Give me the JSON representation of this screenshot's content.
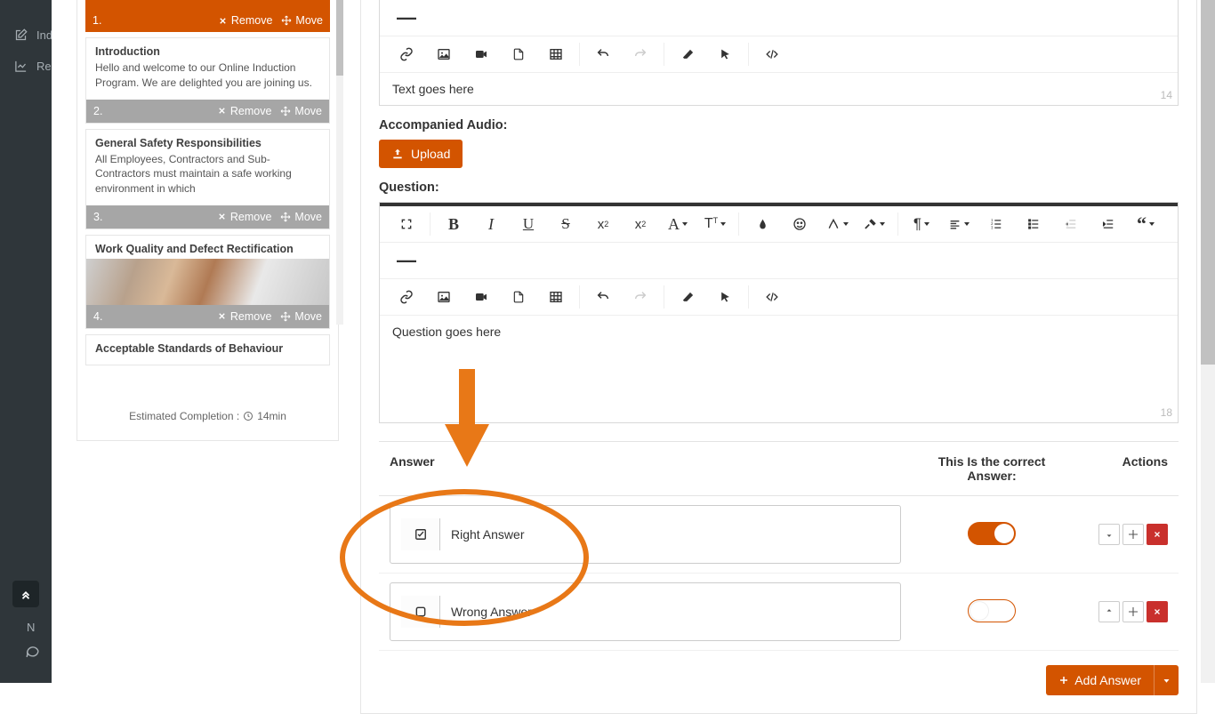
{
  "sidebar_nav": {
    "item1": "Induc",
    "item2": "Repo",
    "bottom_letter": "N"
  },
  "slides": [
    {
      "num": "1.",
      "remove": "Remove",
      "move": "Move"
    },
    {
      "title": "Introduction",
      "text": "Hello and welcome to our Online Induction Program. We are delighted you are joining us.",
      "num": "2.",
      "remove": "Remove",
      "move": "Move"
    },
    {
      "title": "General Safety Responsibilities",
      "text": "All Employees, Contractors and Sub-Contractors must maintain a safe working environment in which",
      "num": "3.",
      "remove": "Remove",
      "move": "Move"
    },
    {
      "title": "Work Quality and Defect Rectification",
      "num": "4.",
      "remove": "Remove",
      "move": "Move"
    },
    {
      "title": "Acceptable Standards of Behaviour"
    }
  ],
  "estimated": {
    "label": "Estimated Completion :",
    "time": "14min"
  },
  "editor1": {
    "content": "Text goes here",
    "count": "14"
  },
  "audio": {
    "label": "Accompanied Audio:",
    "upload": "Upload"
  },
  "question": {
    "label": "Question:",
    "content": "Question goes here",
    "count": "18"
  },
  "answers": {
    "header_answer": "Answer",
    "header_correct": "This Is the correct Answer:",
    "header_actions": "Actions",
    "rows": [
      {
        "text": "Right Answer",
        "correct": true
      },
      {
        "text": "Wrong Answer",
        "correct": false
      }
    ],
    "add_label": "Add Answer"
  },
  "toolbar_glyphs": {
    "dash": "—"
  }
}
